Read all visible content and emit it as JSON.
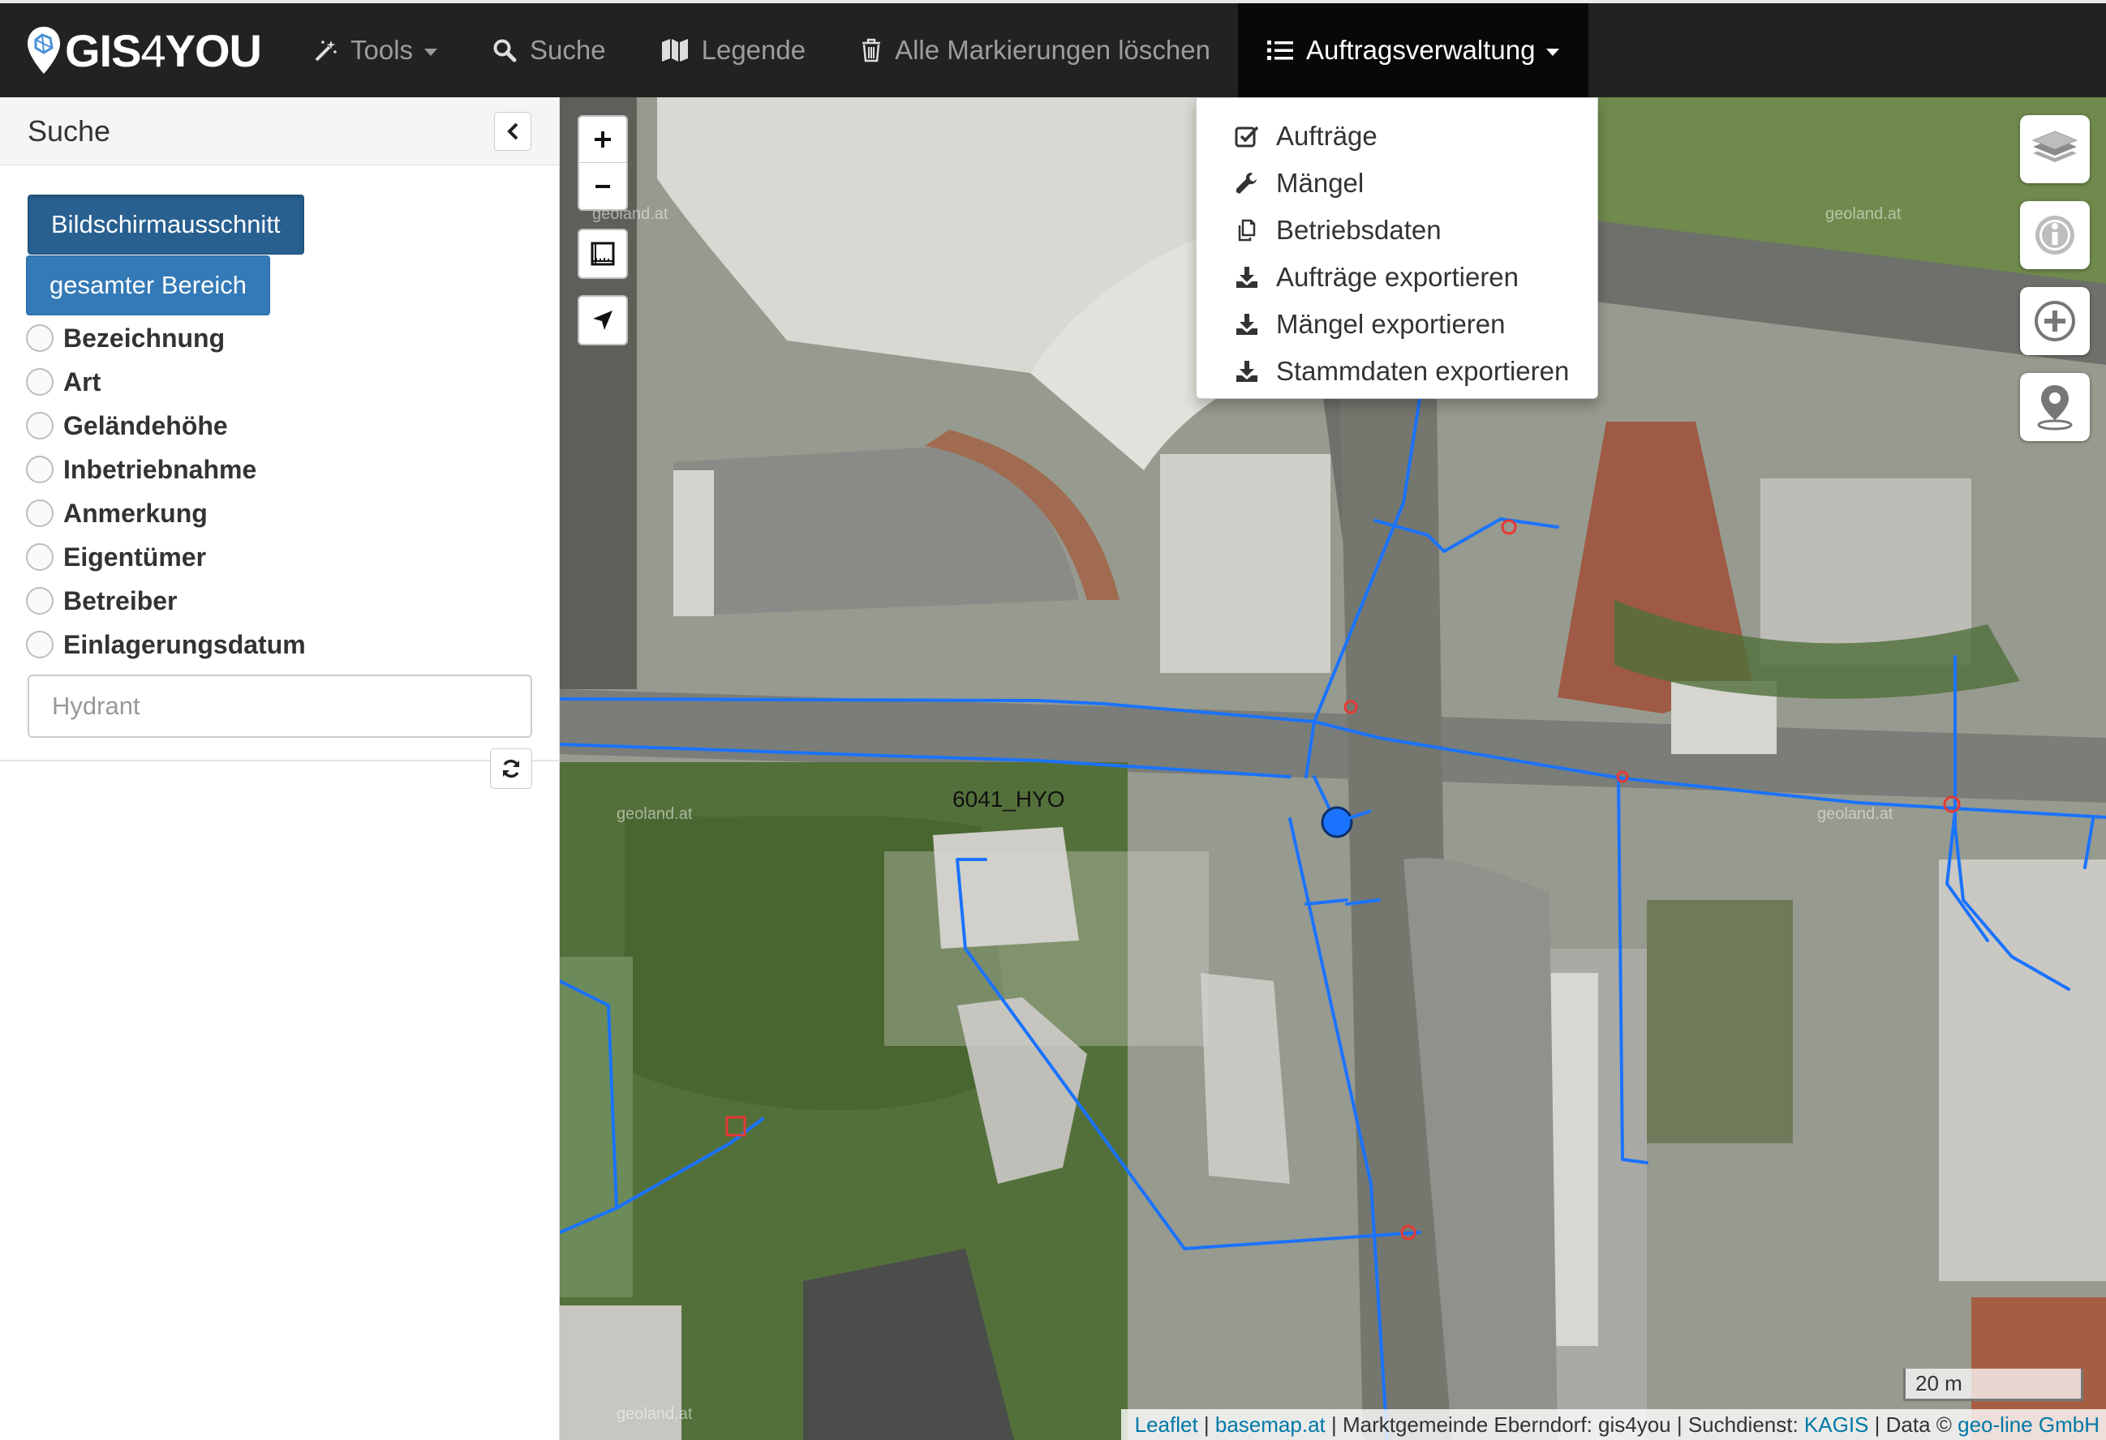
{
  "navbar": {
    "brand_text": "GIS4YOU",
    "brand_prefix": "GIS",
    "brand_four": "4",
    "brand_suffix": "YOU",
    "items": [
      {
        "label": "Tools",
        "icon": "magic-wand-icon",
        "has_caret": true
      },
      {
        "label": "Suche",
        "icon": "search-icon",
        "has_caret": false
      },
      {
        "label": "Legende",
        "icon": "map-icon",
        "has_caret": false
      },
      {
        "label": "Alle Markierungen löschen",
        "icon": "trash-icon",
        "has_caret": false
      },
      {
        "label": "Auftragsverwaltung",
        "icon": "list-icon",
        "has_caret": true,
        "active": true
      }
    ]
  },
  "dropdown": {
    "items": [
      {
        "label": "Aufträge",
        "icon": "check-square-icon"
      },
      {
        "label": "Mängel",
        "icon": "wrench-icon"
      },
      {
        "label": "Betriebsdaten",
        "icon": "copy-icon"
      },
      {
        "label": "Aufträge exportieren",
        "icon": "download-icon"
      },
      {
        "label": "Mängel exportieren",
        "icon": "download-icon"
      },
      {
        "label": "Stammdaten exportieren",
        "icon": "download-icon"
      }
    ]
  },
  "sidebar": {
    "title": "Suche",
    "btn_viewport": "Bildschirmausschnitt",
    "btn_full_area": "gesamter Bereich",
    "fields": [
      "Bezeichnung",
      "Art",
      "Geländehöhe",
      "Inbetriebnahme",
      "Anmerkung",
      "Eigentümer",
      "Betreiber",
      "Einlagerungsdatum"
    ],
    "search_placeholder": "Hydrant"
  },
  "map": {
    "marker_label": "6041_HYO",
    "scale_text": "20 m",
    "watermark": "geoland.at",
    "attribution": {
      "leaflet": "Leaflet",
      "sep1": " | ",
      "basemap": "basemap.at",
      "sep2": " | Marktgemeinde Eberndorf: gis4you | Suchdienst: ",
      "kagis": "KAGIS",
      "sep3": " | Data © ",
      "geoline": "geo-line GmbH"
    },
    "colors": {
      "pipe": "#1a73ff",
      "marker": "#1a73ff",
      "valve": "#e53935"
    }
  }
}
